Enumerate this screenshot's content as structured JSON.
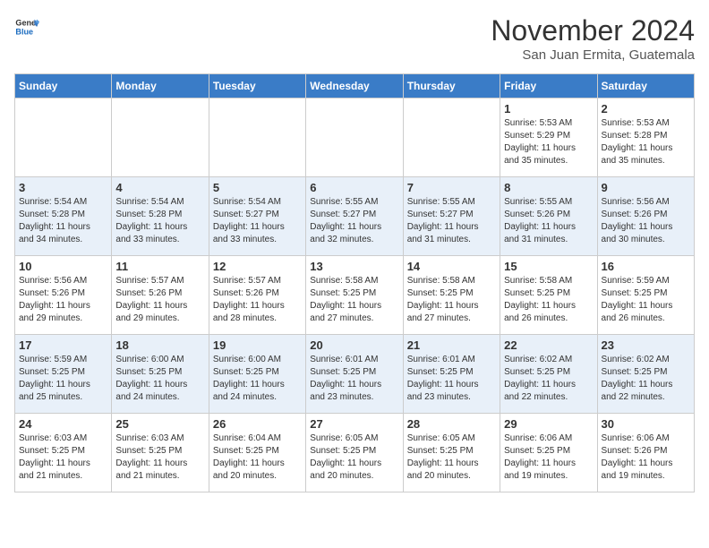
{
  "logo": {
    "line1": "General",
    "line2": "Blue"
  },
  "header": {
    "month": "November 2024",
    "location": "San Juan Ermita, Guatemala"
  },
  "weekdays": [
    "Sunday",
    "Monday",
    "Tuesday",
    "Wednesday",
    "Thursday",
    "Friday",
    "Saturday"
  ],
  "weeks": [
    [
      {
        "day": "",
        "info": ""
      },
      {
        "day": "",
        "info": ""
      },
      {
        "day": "",
        "info": ""
      },
      {
        "day": "",
        "info": ""
      },
      {
        "day": "",
        "info": ""
      },
      {
        "day": "1",
        "info": "Sunrise: 5:53 AM\nSunset: 5:29 PM\nDaylight: 11 hours\nand 35 minutes."
      },
      {
        "day": "2",
        "info": "Sunrise: 5:53 AM\nSunset: 5:28 PM\nDaylight: 11 hours\nand 35 minutes."
      }
    ],
    [
      {
        "day": "3",
        "info": "Sunrise: 5:54 AM\nSunset: 5:28 PM\nDaylight: 11 hours\nand 34 minutes."
      },
      {
        "day": "4",
        "info": "Sunrise: 5:54 AM\nSunset: 5:28 PM\nDaylight: 11 hours\nand 33 minutes."
      },
      {
        "day": "5",
        "info": "Sunrise: 5:54 AM\nSunset: 5:27 PM\nDaylight: 11 hours\nand 33 minutes."
      },
      {
        "day": "6",
        "info": "Sunrise: 5:55 AM\nSunset: 5:27 PM\nDaylight: 11 hours\nand 32 minutes."
      },
      {
        "day": "7",
        "info": "Sunrise: 5:55 AM\nSunset: 5:27 PM\nDaylight: 11 hours\nand 31 minutes."
      },
      {
        "day": "8",
        "info": "Sunrise: 5:55 AM\nSunset: 5:26 PM\nDaylight: 11 hours\nand 31 minutes."
      },
      {
        "day": "9",
        "info": "Sunrise: 5:56 AM\nSunset: 5:26 PM\nDaylight: 11 hours\nand 30 minutes."
      }
    ],
    [
      {
        "day": "10",
        "info": "Sunrise: 5:56 AM\nSunset: 5:26 PM\nDaylight: 11 hours\nand 29 minutes."
      },
      {
        "day": "11",
        "info": "Sunrise: 5:57 AM\nSunset: 5:26 PM\nDaylight: 11 hours\nand 29 minutes."
      },
      {
        "day": "12",
        "info": "Sunrise: 5:57 AM\nSunset: 5:26 PM\nDaylight: 11 hours\nand 28 minutes."
      },
      {
        "day": "13",
        "info": "Sunrise: 5:58 AM\nSunset: 5:25 PM\nDaylight: 11 hours\nand 27 minutes."
      },
      {
        "day": "14",
        "info": "Sunrise: 5:58 AM\nSunset: 5:25 PM\nDaylight: 11 hours\nand 27 minutes."
      },
      {
        "day": "15",
        "info": "Sunrise: 5:58 AM\nSunset: 5:25 PM\nDaylight: 11 hours\nand 26 minutes."
      },
      {
        "day": "16",
        "info": "Sunrise: 5:59 AM\nSunset: 5:25 PM\nDaylight: 11 hours\nand 26 minutes."
      }
    ],
    [
      {
        "day": "17",
        "info": "Sunrise: 5:59 AM\nSunset: 5:25 PM\nDaylight: 11 hours\nand 25 minutes."
      },
      {
        "day": "18",
        "info": "Sunrise: 6:00 AM\nSunset: 5:25 PM\nDaylight: 11 hours\nand 24 minutes."
      },
      {
        "day": "19",
        "info": "Sunrise: 6:00 AM\nSunset: 5:25 PM\nDaylight: 11 hours\nand 24 minutes."
      },
      {
        "day": "20",
        "info": "Sunrise: 6:01 AM\nSunset: 5:25 PM\nDaylight: 11 hours\nand 23 minutes."
      },
      {
        "day": "21",
        "info": "Sunrise: 6:01 AM\nSunset: 5:25 PM\nDaylight: 11 hours\nand 23 minutes."
      },
      {
        "day": "22",
        "info": "Sunrise: 6:02 AM\nSunset: 5:25 PM\nDaylight: 11 hours\nand 22 minutes."
      },
      {
        "day": "23",
        "info": "Sunrise: 6:02 AM\nSunset: 5:25 PM\nDaylight: 11 hours\nand 22 minutes."
      }
    ],
    [
      {
        "day": "24",
        "info": "Sunrise: 6:03 AM\nSunset: 5:25 PM\nDaylight: 11 hours\nand 21 minutes."
      },
      {
        "day": "25",
        "info": "Sunrise: 6:03 AM\nSunset: 5:25 PM\nDaylight: 11 hours\nand 21 minutes."
      },
      {
        "day": "26",
        "info": "Sunrise: 6:04 AM\nSunset: 5:25 PM\nDaylight: 11 hours\nand 20 minutes."
      },
      {
        "day": "27",
        "info": "Sunrise: 6:05 AM\nSunset: 5:25 PM\nDaylight: 11 hours\nand 20 minutes."
      },
      {
        "day": "28",
        "info": "Sunrise: 6:05 AM\nSunset: 5:25 PM\nDaylight: 11 hours\nand 20 minutes."
      },
      {
        "day": "29",
        "info": "Sunrise: 6:06 AM\nSunset: 5:25 PM\nDaylight: 11 hours\nand 19 minutes."
      },
      {
        "day": "30",
        "info": "Sunrise: 6:06 AM\nSunset: 5:26 PM\nDaylight: 11 hours\nand 19 minutes."
      }
    ]
  ]
}
